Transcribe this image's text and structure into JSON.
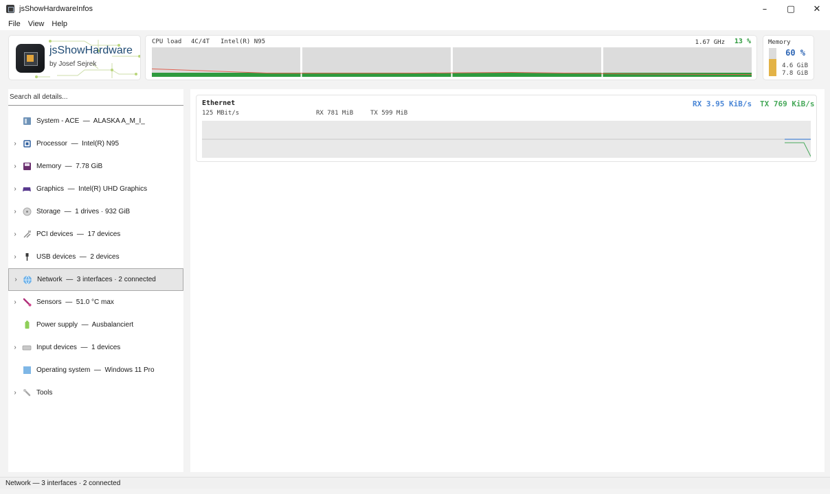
{
  "window": {
    "title": "jsShowHardwareInfos",
    "minimize": "–",
    "maximize": "▢",
    "close": "✕"
  },
  "menu": [
    "File",
    "View",
    "Help"
  ],
  "logo": {
    "name": "jsShowHardware",
    "author": "by Josef Sejrek"
  },
  "cpu": {
    "label": "CPU load",
    "cores": "4C/4T",
    "model": "Intel(R) N95",
    "freq": "1.67 GHz",
    "load": "13 %",
    "load_history": [
      0.27,
      0.12,
      0.12,
      0.15,
      0.1,
      0.08
    ]
  },
  "memory": {
    "label": "Memory",
    "percent": "60 %",
    "fraction": 0.6,
    "used": "4.6 GiB",
    "total": "7.8 GiB"
  },
  "search": {
    "placeholder": "Search all details..."
  },
  "tree": [
    {
      "label": "System - ACE  —  ALASKA A_M_I_",
      "icon": "system-icon",
      "expandable": false
    },
    {
      "label": "Processor  —  Intel(R) N95",
      "icon": "processor-icon",
      "expandable": true
    },
    {
      "label": "Memory  —  7.78 GiB",
      "icon": "memory-icon",
      "expandable": true
    },
    {
      "label": "Graphics  —  Intel(R) UHD Graphics",
      "icon": "gamepad-icon",
      "expandable": true
    },
    {
      "label": "Storage  —  1 drives · 932 GiB",
      "icon": "disk-icon",
      "expandable": true
    },
    {
      "label": "PCI devices  —  17 devices",
      "icon": "pci-icon",
      "expandable": true
    },
    {
      "label": "USB devices  —  2 devices",
      "icon": "usb-icon",
      "expandable": true
    },
    {
      "label": "Network  —  3 interfaces · 2 connected",
      "icon": "globe-icon",
      "expandable": true,
      "selected": true
    },
    {
      "label": "Sensors  —  51.0 °C max",
      "icon": "thermometer-icon",
      "expandable": true
    },
    {
      "label": "Power supply  —  Ausbalanciert",
      "icon": "battery-icon",
      "expandable": false
    },
    {
      "label": "Input devices  —  1 devices",
      "icon": "keyboard-icon",
      "expandable": true
    },
    {
      "label": "Operating system  —  Windows 11 Pro",
      "icon": "windows-icon",
      "expandable": false
    },
    {
      "label": "Tools",
      "icon": "wrench-icon",
      "expandable": true
    }
  ],
  "network": {
    "name": "Ethernet",
    "link_speed": "125 MBit/s",
    "rx_total": "RX 781 MiB",
    "tx_total": "TX 599 MiB",
    "rx_rate": "RX 3.95 KiB/s",
    "tx_rate": "TX 769 KiB/s"
  },
  "status": "Network — 3 interfaces · 2 connected",
  "colors": {
    "accent_blue": "#2e66b5",
    "rx": "#4a86d6",
    "tx": "#47a95a",
    "cpu_line": "#e06050",
    "cpu_fill": "#2e9a3e",
    "mem_fill": "#e3b347"
  }
}
